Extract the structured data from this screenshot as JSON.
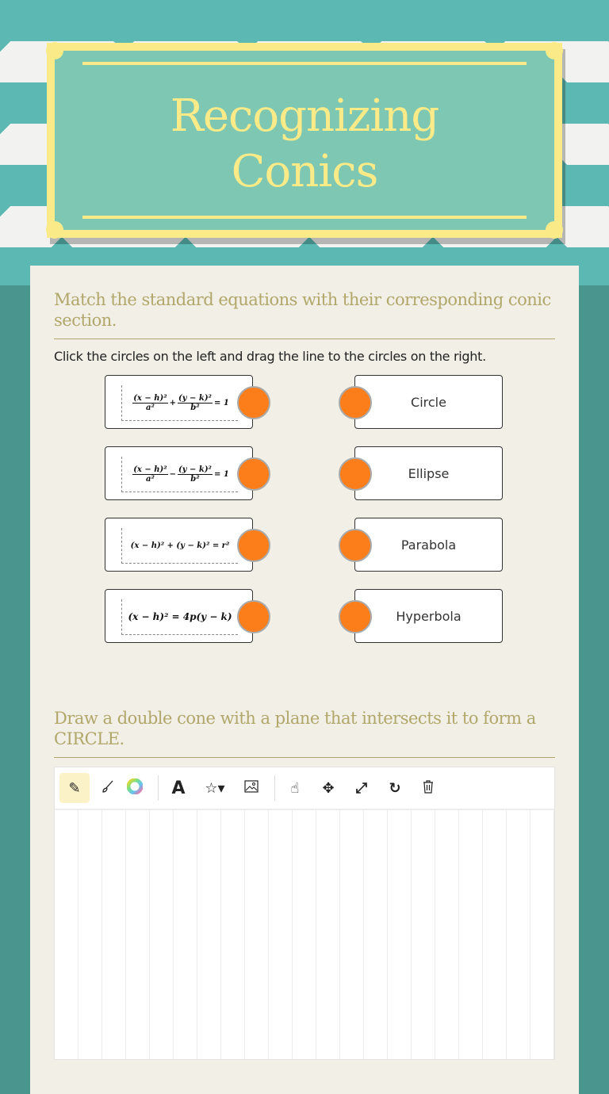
{
  "header": {
    "title_line1": "Recognizing",
    "title_line2": "Conics"
  },
  "colors": {
    "accent_orange": "#fb7e1b",
    "teal": "#7ec7b3",
    "yellow": "#fbeb88",
    "heading": "#b1a76a"
  },
  "matching": {
    "heading": "Match the standard equations with their corresponding conic section.",
    "instruction": "Click the circles on the left and drag the line to the circles on the right.",
    "left_items": [
      {
        "equation": "(x − h)²/a² + (y − k)²/b² = 1"
      },
      {
        "equation": "(x − h)²/a² − (y − k)²/b² = 1"
      },
      {
        "equation": "(x − h)² + (y − k)² = r²"
      },
      {
        "equation": "(x − h)² = 4p(y − k)"
      }
    ],
    "right_items": [
      {
        "label": "Circle"
      },
      {
        "label": "Ellipse"
      },
      {
        "label": "Parabola"
      },
      {
        "label": "Hyperbola"
      }
    ],
    "eq_parts": {
      "xh2": "(x − h)²",
      "yk2": "(y − k)²",
      "a2": "a²",
      "b2": "b²",
      "plus": "+",
      "minus": "−",
      "eq1": "= 1",
      "circle_eq": "(x − h)² + (y − k)² = r²",
      "parabola_eq": "(x − h)² = 4p(y − k)"
    }
  },
  "drawing": {
    "heading": "Draw a double cone with a plane that intersects it to form a CIRCLE.",
    "tools": [
      {
        "name": "pencil",
        "icon": "✎",
        "active": true
      },
      {
        "name": "brush",
        "icon": "🖌"
      },
      {
        "name": "color",
        "icon": "◕"
      },
      {
        "name": "text",
        "icon": "A"
      },
      {
        "name": "shapes",
        "icon": "☆▾"
      },
      {
        "name": "image",
        "icon": "🖼"
      },
      {
        "name": "hand",
        "icon": "☝"
      },
      {
        "name": "move",
        "icon": "✥"
      },
      {
        "name": "resize",
        "icon": "⤢"
      },
      {
        "name": "redo",
        "icon": "↻"
      },
      {
        "name": "delete",
        "icon": "🗑"
      }
    ]
  }
}
